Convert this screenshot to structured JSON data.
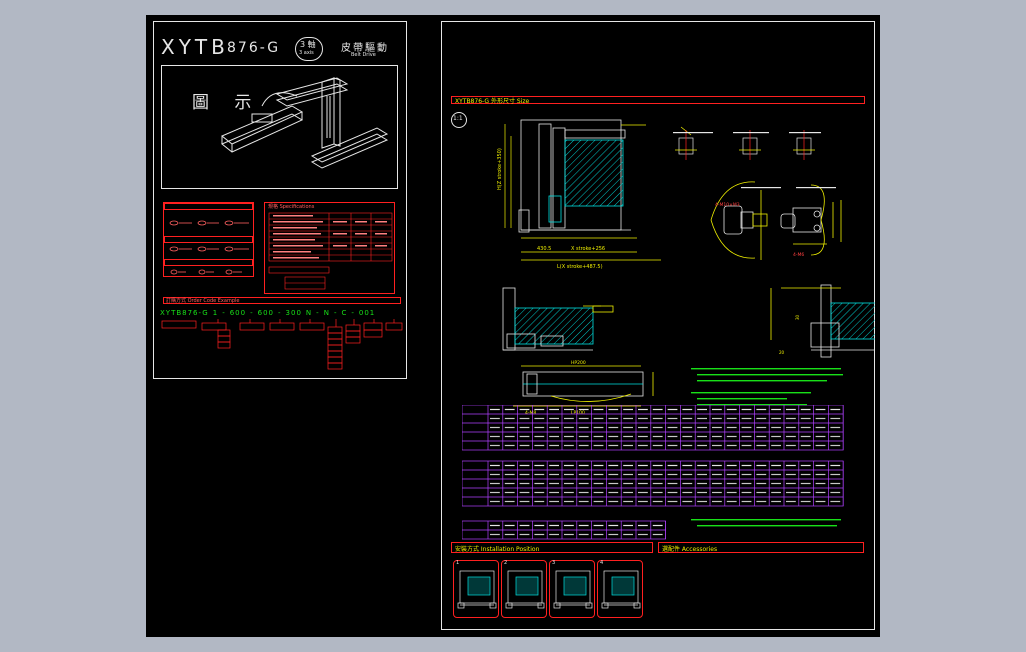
{
  "title": {
    "model_main": "XYTB",
    "model_sub": "876-G",
    "axis_badge_top": "3 軸",
    "axis_badge_bottom": "3 axis",
    "drive_cn": "皮帶驅動",
    "drive_en": "Belt Drive"
  },
  "illustration": {
    "label": "圖 示"
  },
  "left_panel": {
    "spec_header": "規格 Specifications",
    "order_header": "訂購方式 Order Code Example",
    "order_code": [
      "XYTB876-G",
      "1",
      "-",
      "600",
      "-",
      "600",
      "-",
      "300",
      "N",
      "-",
      "N",
      "-",
      "C",
      "-",
      "001"
    ]
  },
  "right_panel": {
    "dimension_header": "XYTB876-G 外形尺寸 Size",
    "scale_badge": "1:1",
    "dimension_labels": {
      "height_label": "H(Z stroke+350)",
      "x_label": "X stroke+256",
      "l_label": "L(X stroke+487.5)",
      "hp_label": "HP200",
      "lp_label": "LP100",
      "bolt_label": "4-M8",
      "hole_label": "4-M10×M3",
      "hole_label_2": "4-M6",
      "dim_430": "430.5",
      "dim_30": "30",
      "dim_20": "20"
    },
    "install_header": "安裝方式 Installation Position",
    "accessories_header": "選配件 Accessories",
    "install_tabs": [
      "1",
      "2",
      "3",
      "4"
    ]
  },
  "colors": {
    "frame": "#e6e6e6",
    "red": "#ff2020",
    "green": "#18e018",
    "cyan": "#00e0e0",
    "yellow": "#f0f000",
    "purple": "#b040ff",
    "white": "#e6e6e6"
  }
}
